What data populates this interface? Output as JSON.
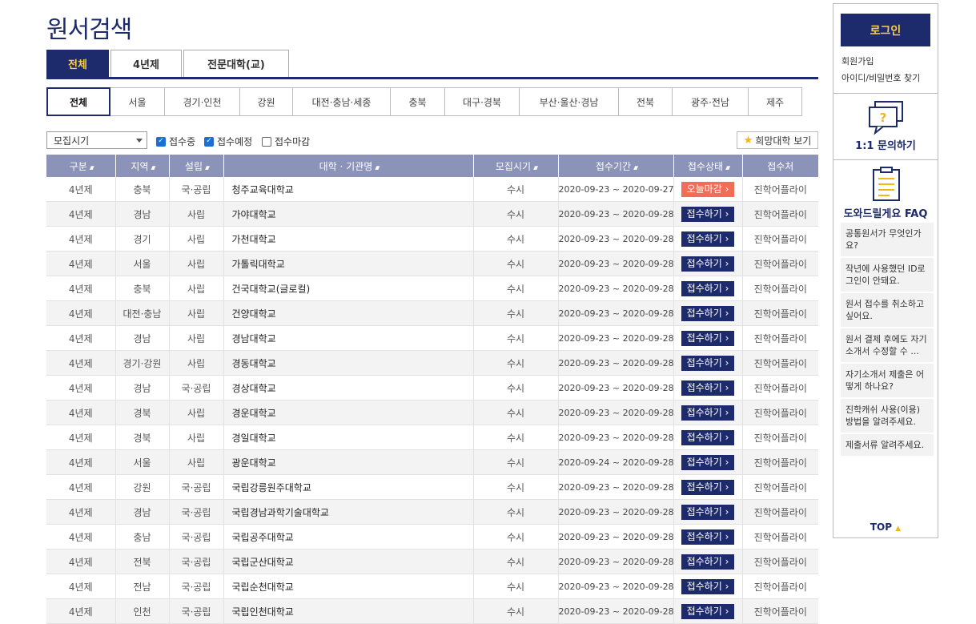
{
  "page_title": "원서검색",
  "tabs": [
    {
      "label": "전체",
      "active": true
    },
    {
      "label": "4년제",
      "active": false
    },
    {
      "label": "전문대학(교)",
      "active": false
    }
  ],
  "regions": [
    {
      "label": "전체",
      "active": true
    },
    {
      "label": "서울"
    },
    {
      "label": "경기·인천"
    },
    {
      "label": "강원"
    },
    {
      "label": "대전·충남·세종"
    },
    {
      "label": "충북"
    },
    {
      "label": "대구·경북"
    },
    {
      "label": "부산·울산·경남"
    },
    {
      "label": "전북"
    },
    {
      "label": "광주·전남"
    },
    {
      "label": "제주"
    }
  ],
  "filters": {
    "select_value": "모집시기",
    "checkboxes": [
      {
        "label": "접수중",
        "checked": true
      },
      {
        "label": "접수예정",
        "checked": true
      },
      {
        "label": "접수마감",
        "checked": false
      }
    ],
    "wish_label": "희망대학 보기"
  },
  "table": {
    "headers": [
      {
        "label": "구분",
        "sortable": true
      },
      {
        "label": "지역",
        "sortable": true
      },
      {
        "label": "설립",
        "sortable": true
      },
      {
        "label": "대학 · 기관명",
        "sortable": true
      },
      {
        "label": "모집시기",
        "sortable": true
      },
      {
        "label": "접수기간",
        "sortable": true
      },
      {
        "label": "접수상태",
        "sortable": true
      },
      {
        "label": "접수처",
        "sortable": false
      }
    ],
    "rows": [
      {
        "type": "4년제",
        "region": "충북",
        "est": "국·공립",
        "name": "청주교육대학교",
        "period": "수시",
        "dates": "2020-09-23 ~ 2020-09-27",
        "status": "오늘마감",
        "status_kind": "today",
        "agency": "진학어플라이"
      },
      {
        "type": "4년제",
        "region": "경남",
        "est": "사립",
        "name": "가야대학교",
        "period": "수시",
        "dates": "2020-09-23 ~ 2020-09-28",
        "status": "접수하기",
        "status_kind": "open",
        "agency": "진학어플라이"
      },
      {
        "type": "4년제",
        "region": "경기",
        "est": "사립",
        "name": "가천대학교",
        "period": "수시",
        "dates": "2020-09-23 ~ 2020-09-28",
        "status": "접수하기",
        "status_kind": "open",
        "agency": "진학어플라이"
      },
      {
        "type": "4년제",
        "region": "서울",
        "est": "사립",
        "name": "가톨릭대학교",
        "period": "수시",
        "dates": "2020-09-23 ~ 2020-09-28",
        "status": "접수하기",
        "status_kind": "open",
        "agency": "진학어플라이"
      },
      {
        "type": "4년제",
        "region": "충북",
        "est": "사립",
        "name": "건국대학교(글로컬)",
        "period": "수시",
        "dates": "2020-09-23 ~ 2020-09-28",
        "status": "접수하기",
        "status_kind": "open",
        "agency": "진학어플라이"
      },
      {
        "type": "4년제",
        "region": "대전·충남",
        "est": "사립",
        "name": "건양대학교",
        "period": "수시",
        "dates": "2020-09-23 ~ 2020-09-28",
        "status": "접수하기",
        "status_kind": "open",
        "agency": "진학어플라이"
      },
      {
        "type": "4년제",
        "region": "경남",
        "est": "사립",
        "name": "경남대학교",
        "period": "수시",
        "dates": "2020-09-23 ~ 2020-09-28",
        "status": "접수하기",
        "status_kind": "open",
        "agency": "진학어플라이"
      },
      {
        "type": "4년제",
        "region": "경기·강원",
        "est": "사립",
        "name": "경동대학교",
        "period": "수시",
        "dates": "2020-09-23 ~ 2020-09-28",
        "status": "접수하기",
        "status_kind": "open",
        "agency": "진학어플라이"
      },
      {
        "type": "4년제",
        "region": "경남",
        "est": "국·공립",
        "name": "경상대학교",
        "period": "수시",
        "dates": "2020-09-23 ~ 2020-09-28",
        "status": "접수하기",
        "status_kind": "open",
        "agency": "진학어플라이"
      },
      {
        "type": "4년제",
        "region": "경북",
        "est": "사립",
        "name": "경운대학교",
        "period": "수시",
        "dates": "2020-09-23 ~ 2020-09-28",
        "status": "접수하기",
        "status_kind": "open",
        "agency": "진학어플라이"
      },
      {
        "type": "4년제",
        "region": "경북",
        "est": "사립",
        "name": "경일대학교",
        "period": "수시",
        "dates": "2020-09-23 ~ 2020-09-28",
        "status": "접수하기",
        "status_kind": "open",
        "agency": "진학어플라이"
      },
      {
        "type": "4년제",
        "region": "서울",
        "est": "사립",
        "name": "광운대학교",
        "period": "수시",
        "dates": "2020-09-24 ~ 2020-09-28",
        "status": "접수하기",
        "status_kind": "open",
        "agency": "진학어플라이"
      },
      {
        "type": "4년제",
        "region": "강원",
        "est": "국·공립",
        "name": "국립강릉원주대학교",
        "period": "수시",
        "dates": "2020-09-23 ~ 2020-09-28",
        "status": "접수하기",
        "status_kind": "open",
        "agency": "진학어플라이"
      },
      {
        "type": "4년제",
        "region": "경남",
        "est": "국·공립",
        "name": "국립경남과학기술대학교",
        "period": "수시",
        "dates": "2020-09-23 ~ 2020-09-28",
        "status": "접수하기",
        "status_kind": "open",
        "agency": "진학어플라이"
      },
      {
        "type": "4년제",
        "region": "충남",
        "est": "국·공립",
        "name": "국립공주대학교",
        "period": "수시",
        "dates": "2020-09-23 ~ 2020-09-28",
        "status": "접수하기",
        "status_kind": "open",
        "agency": "진학어플라이"
      },
      {
        "type": "4년제",
        "region": "전북",
        "est": "국·공립",
        "name": "국립군산대학교",
        "period": "수시",
        "dates": "2020-09-23 ~ 2020-09-28",
        "status": "접수하기",
        "status_kind": "open",
        "agency": "진학어플라이"
      },
      {
        "type": "4년제",
        "region": "전남",
        "est": "국·공립",
        "name": "국립순천대학교",
        "period": "수시",
        "dates": "2020-09-23 ~ 2020-09-28",
        "status": "접수하기",
        "status_kind": "open",
        "agency": "진학어플라이"
      },
      {
        "type": "4년제",
        "region": "인천",
        "est": "국·공립",
        "name": "국립인천대학교",
        "period": "수시",
        "dates": "2020-09-23 ~ 2020-09-28",
        "status": "접수하기",
        "status_kind": "open",
        "agency": "진학어플라이"
      }
    ]
  },
  "sidebar": {
    "login_label": "로그인",
    "signup_label": "회원가입",
    "find_label": "아이디/비밀번호 찾기",
    "qna_label": "1:1 문의하기",
    "faq_label": "도와드릴게요 FAQ",
    "faq_items": [
      "공통원서가 무엇인가요?",
      "작년에 사용했던 ID로그인이 안돼요.",
      "원서 접수를 취소하고 싶어요.",
      "원서 결제 후에도 자기소개서 수정할 수 ...",
      "자기소개서 제출은 어떻게 하나요?",
      "진학캐쉬 사용(이용) 방법을 알려주세요.",
      "제출서류 알려주세요."
    ],
    "top_label": "TOP"
  },
  "colors": {
    "brand_navy": "#1d2a6b",
    "accent_yellow": "#f5d04a",
    "table_header": "#8c93b8",
    "today_red": "#f26d56"
  }
}
